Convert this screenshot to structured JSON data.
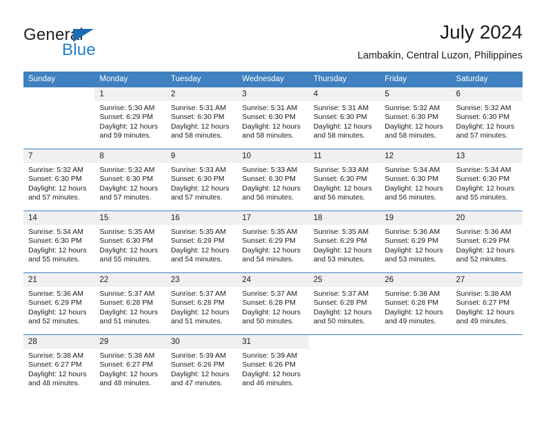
{
  "logo": {
    "word1": "General",
    "word2": "Blue",
    "triangle_color": "#1b6cb5",
    "blue_color": "#1f7ec4"
  },
  "header": {
    "title": "July 2024",
    "subtitle": "Lambakin, Central Luzon, Philippines"
  },
  "theme": {
    "header_bg": "#3f80c0",
    "header_text": "#ffffff",
    "daynum_bg": "#f0f0f0",
    "row_border": "#3f80c0"
  },
  "weekday_headers": [
    "Sunday",
    "Monday",
    "Tuesday",
    "Wednesday",
    "Thursday",
    "Friday",
    "Saturday"
  ],
  "weeks": [
    [
      {
        "day": "",
        "blank": true,
        "sunrise": "",
        "sunset": "",
        "daylight1": "",
        "daylight2": ""
      },
      {
        "day": "1",
        "sunrise": "Sunrise: 5:30 AM",
        "sunset": "Sunset: 6:29 PM",
        "daylight1": "Daylight: 12 hours",
        "daylight2": "and 59 minutes."
      },
      {
        "day": "2",
        "sunrise": "Sunrise: 5:31 AM",
        "sunset": "Sunset: 6:30 PM",
        "daylight1": "Daylight: 12 hours",
        "daylight2": "and 58 minutes."
      },
      {
        "day": "3",
        "sunrise": "Sunrise: 5:31 AM",
        "sunset": "Sunset: 6:30 PM",
        "daylight1": "Daylight: 12 hours",
        "daylight2": "and 58 minutes."
      },
      {
        "day": "4",
        "sunrise": "Sunrise: 5:31 AM",
        "sunset": "Sunset: 6:30 PM",
        "daylight1": "Daylight: 12 hours",
        "daylight2": "and 58 minutes."
      },
      {
        "day": "5",
        "sunrise": "Sunrise: 5:32 AM",
        "sunset": "Sunset: 6:30 PM",
        "daylight1": "Daylight: 12 hours",
        "daylight2": "and 58 minutes."
      },
      {
        "day": "6",
        "sunrise": "Sunrise: 5:32 AM",
        "sunset": "Sunset: 6:30 PM",
        "daylight1": "Daylight: 12 hours",
        "daylight2": "and 57 minutes."
      }
    ],
    [
      {
        "day": "7",
        "sunrise": "Sunrise: 5:32 AM",
        "sunset": "Sunset: 6:30 PM",
        "daylight1": "Daylight: 12 hours",
        "daylight2": "and 57 minutes."
      },
      {
        "day": "8",
        "sunrise": "Sunrise: 5:32 AM",
        "sunset": "Sunset: 6:30 PM",
        "daylight1": "Daylight: 12 hours",
        "daylight2": "and 57 minutes."
      },
      {
        "day": "9",
        "sunrise": "Sunrise: 5:33 AM",
        "sunset": "Sunset: 6:30 PM",
        "daylight1": "Daylight: 12 hours",
        "daylight2": "and 57 minutes."
      },
      {
        "day": "10",
        "sunrise": "Sunrise: 5:33 AM",
        "sunset": "Sunset: 6:30 PM",
        "daylight1": "Daylight: 12 hours",
        "daylight2": "and 56 minutes."
      },
      {
        "day": "11",
        "sunrise": "Sunrise: 5:33 AM",
        "sunset": "Sunset: 6:30 PM",
        "daylight1": "Daylight: 12 hours",
        "daylight2": "and 56 minutes."
      },
      {
        "day": "12",
        "sunrise": "Sunrise: 5:34 AM",
        "sunset": "Sunset: 6:30 PM",
        "daylight1": "Daylight: 12 hours",
        "daylight2": "and 56 minutes."
      },
      {
        "day": "13",
        "sunrise": "Sunrise: 5:34 AM",
        "sunset": "Sunset: 6:30 PM",
        "daylight1": "Daylight: 12 hours",
        "daylight2": "and 55 minutes."
      }
    ],
    [
      {
        "day": "14",
        "sunrise": "Sunrise: 5:34 AM",
        "sunset": "Sunset: 6:30 PM",
        "daylight1": "Daylight: 12 hours",
        "daylight2": "and 55 minutes."
      },
      {
        "day": "15",
        "sunrise": "Sunrise: 5:35 AM",
        "sunset": "Sunset: 6:30 PM",
        "daylight1": "Daylight: 12 hours",
        "daylight2": "and 55 minutes."
      },
      {
        "day": "16",
        "sunrise": "Sunrise: 5:35 AM",
        "sunset": "Sunset: 6:29 PM",
        "daylight1": "Daylight: 12 hours",
        "daylight2": "and 54 minutes."
      },
      {
        "day": "17",
        "sunrise": "Sunrise: 5:35 AM",
        "sunset": "Sunset: 6:29 PM",
        "daylight1": "Daylight: 12 hours",
        "daylight2": "and 54 minutes."
      },
      {
        "day": "18",
        "sunrise": "Sunrise: 5:35 AM",
        "sunset": "Sunset: 6:29 PM",
        "daylight1": "Daylight: 12 hours",
        "daylight2": "and 53 minutes."
      },
      {
        "day": "19",
        "sunrise": "Sunrise: 5:36 AM",
        "sunset": "Sunset: 6:29 PM",
        "daylight1": "Daylight: 12 hours",
        "daylight2": "and 53 minutes."
      },
      {
        "day": "20",
        "sunrise": "Sunrise: 5:36 AM",
        "sunset": "Sunset: 6:29 PM",
        "daylight1": "Daylight: 12 hours",
        "daylight2": "and 52 minutes."
      }
    ],
    [
      {
        "day": "21",
        "sunrise": "Sunrise: 5:36 AM",
        "sunset": "Sunset: 6:29 PM",
        "daylight1": "Daylight: 12 hours",
        "daylight2": "and 52 minutes."
      },
      {
        "day": "22",
        "sunrise": "Sunrise: 5:37 AM",
        "sunset": "Sunset: 6:28 PM",
        "daylight1": "Daylight: 12 hours",
        "daylight2": "and 51 minutes."
      },
      {
        "day": "23",
        "sunrise": "Sunrise: 5:37 AM",
        "sunset": "Sunset: 6:28 PM",
        "daylight1": "Daylight: 12 hours",
        "daylight2": "and 51 minutes."
      },
      {
        "day": "24",
        "sunrise": "Sunrise: 5:37 AM",
        "sunset": "Sunset: 6:28 PM",
        "daylight1": "Daylight: 12 hours",
        "daylight2": "and 50 minutes."
      },
      {
        "day": "25",
        "sunrise": "Sunrise: 5:37 AM",
        "sunset": "Sunset: 6:28 PM",
        "daylight1": "Daylight: 12 hours",
        "daylight2": "and 50 minutes."
      },
      {
        "day": "26",
        "sunrise": "Sunrise: 5:38 AM",
        "sunset": "Sunset: 6:28 PM",
        "daylight1": "Daylight: 12 hours",
        "daylight2": "and 49 minutes."
      },
      {
        "day": "27",
        "sunrise": "Sunrise: 5:38 AM",
        "sunset": "Sunset: 6:27 PM",
        "daylight1": "Daylight: 12 hours",
        "daylight2": "and 49 minutes."
      }
    ],
    [
      {
        "day": "28",
        "sunrise": "Sunrise: 5:38 AM",
        "sunset": "Sunset: 6:27 PM",
        "daylight1": "Daylight: 12 hours",
        "daylight2": "and 48 minutes."
      },
      {
        "day": "29",
        "sunrise": "Sunrise: 5:38 AM",
        "sunset": "Sunset: 6:27 PM",
        "daylight1": "Daylight: 12 hours",
        "daylight2": "and 48 minutes."
      },
      {
        "day": "30",
        "sunrise": "Sunrise: 5:39 AM",
        "sunset": "Sunset: 6:26 PM",
        "daylight1": "Daylight: 12 hours",
        "daylight2": "and 47 minutes."
      },
      {
        "day": "31",
        "sunrise": "Sunrise: 5:39 AM",
        "sunset": "Sunset: 6:26 PM",
        "daylight1": "Daylight: 12 hours",
        "daylight2": "and 46 minutes."
      },
      {
        "day": "",
        "blank": true,
        "sunrise": "",
        "sunset": "",
        "daylight1": "",
        "daylight2": ""
      },
      {
        "day": "",
        "blank": true,
        "sunrise": "",
        "sunset": "",
        "daylight1": "",
        "daylight2": ""
      },
      {
        "day": "",
        "blank": true,
        "sunrise": "",
        "sunset": "",
        "daylight1": "",
        "daylight2": ""
      }
    ]
  ]
}
